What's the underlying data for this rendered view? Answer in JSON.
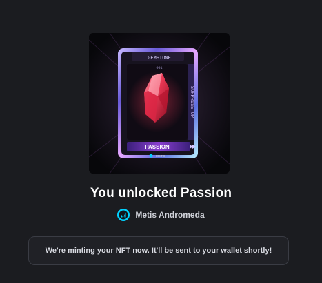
{
  "nft": {
    "card_brand": "GEMSTONE",
    "card_subtitle": "001",
    "card_side_text": "SURPRISE UP",
    "card_name": "PASSION",
    "card_footer": "METIS"
  },
  "title": "You unlocked Passion",
  "network": {
    "icon": "metis-logo-icon",
    "name": "Metis Andromeda"
  },
  "notice": {
    "text": "We're minting your NFT now. It'll be sent to your wallet shortly!"
  },
  "colors": {
    "background": "#1b1c20",
    "gem": "#e8344f",
    "network_accent": "#00d2ff"
  }
}
